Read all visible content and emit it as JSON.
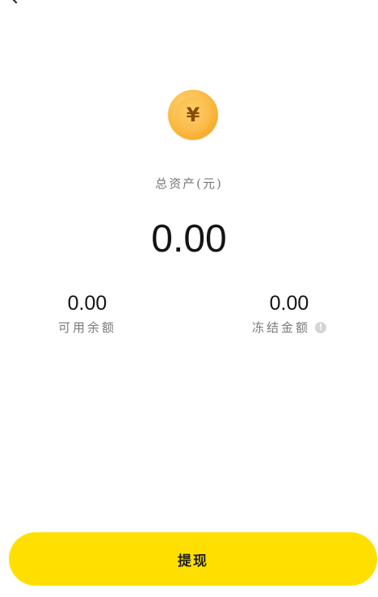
{
  "header": {
    "back_icon": "chevron-left-icon",
    "more_icon": "more-icon"
  },
  "coin": {
    "symbol": "¥",
    "icon": "yuan-coin-icon"
  },
  "total": {
    "label": "总资产(元)",
    "value": "0.00"
  },
  "available": {
    "value": "0.00",
    "label": "可用余额"
  },
  "frozen": {
    "value": "0.00",
    "label": "冻结金额",
    "info_icon": "info-icon",
    "info_symbol": "!"
  },
  "withdraw": {
    "label": "提现"
  },
  "colors": {
    "button_bg": "#ffdf00",
    "coin": "#f9b53a",
    "label": "#777777",
    "value": "#141414"
  }
}
